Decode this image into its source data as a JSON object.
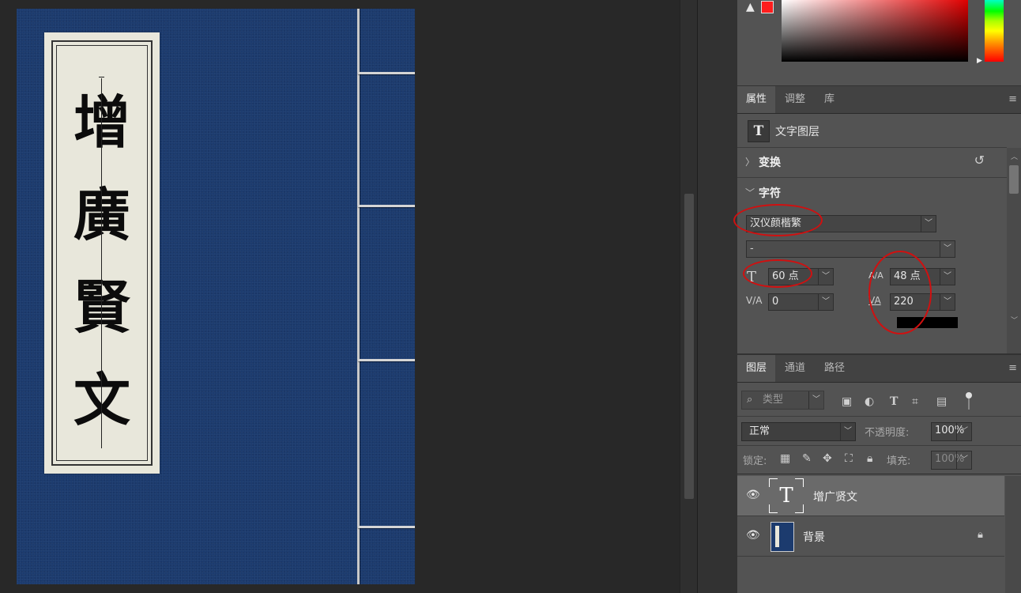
{
  "document": {
    "title_chars": [
      "增",
      "廣",
      "賢",
      "文"
    ]
  },
  "colors": {
    "cover_blue": "#1c3b6e",
    "label_paper": "#e8e7db",
    "foreground_swatch": "#ff1d1d",
    "panel_bg": "#535353",
    "annotation_red": "#d01010"
  },
  "color_panel": {
    "warning_icon": "warning-triangle-icon"
  },
  "properties_panel": {
    "tabs": [
      "属性",
      "调整",
      "库"
    ],
    "layer_type_icon": "T",
    "layer_type_label": "文字图层",
    "transform_section": "变换",
    "character_section": "字符",
    "font_family": "汉仪颜楷繁",
    "font_style": "-",
    "font_size": "60 点",
    "leading": "48 点",
    "kerning": "0",
    "tracking": "220",
    "icons": {
      "font_size": "T",
      "leading": "A/A",
      "kerning": "V/A",
      "tracking": "VA"
    }
  },
  "layers_panel": {
    "tabs": [
      "图层",
      "通道",
      "路径"
    ],
    "filter_placeholder": "类型",
    "blend_mode": "正常",
    "opacity_label": "不透明度:",
    "opacity_value": "100%",
    "lock_label": "锁定:",
    "fill_label": "填充:",
    "fill_value": "100%",
    "layers": [
      {
        "name": "增广贤文",
        "type": "text",
        "selected": true
      },
      {
        "name": "背景",
        "type": "image",
        "locked": true
      }
    ]
  }
}
